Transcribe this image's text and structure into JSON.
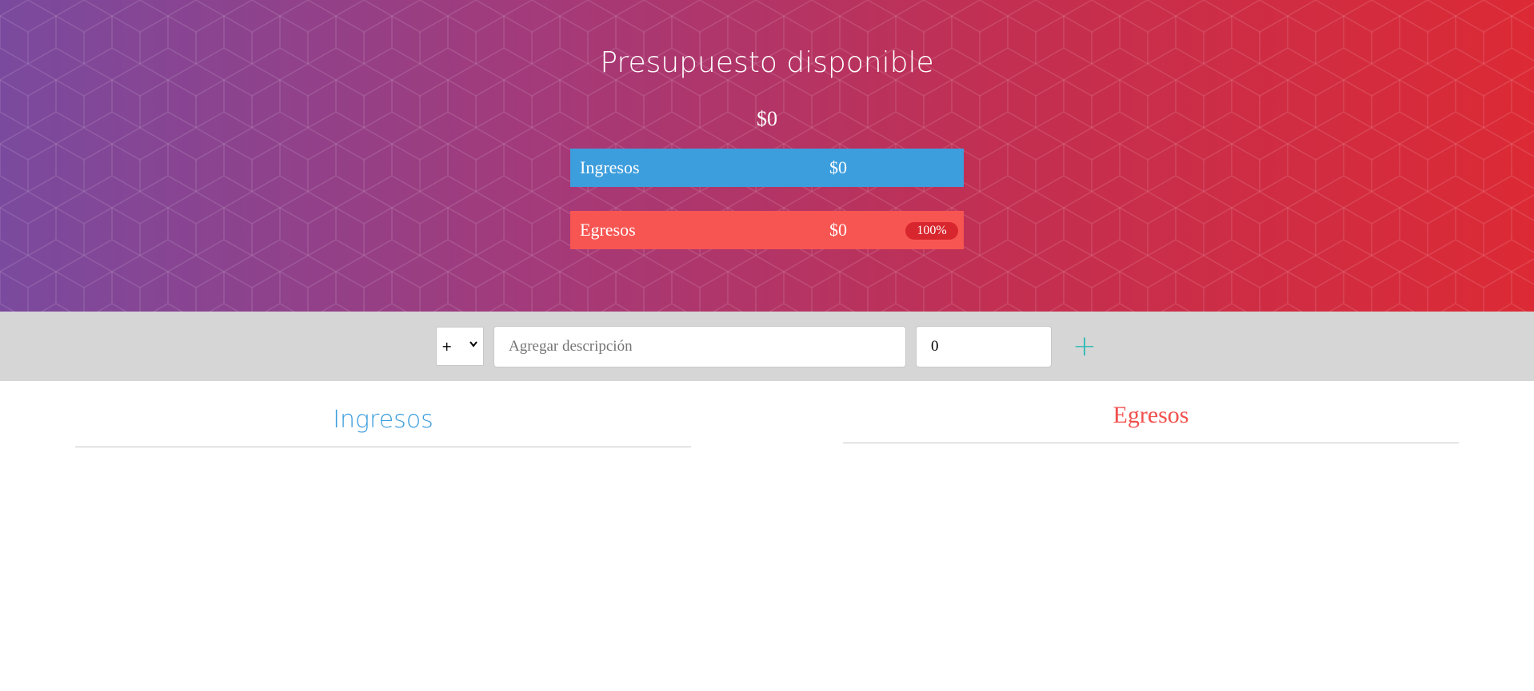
{
  "header": {
    "title": "Presupuesto disponible",
    "total": "$0",
    "ingresos": {
      "label": "Ingresos",
      "value": "$0"
    },
    "egresos": {
      "label": "Egresos",
      "value": "$0",
      "percentage": "100%"
    }
  },
  "add_bar": {
    "type_selected": "+",
    "type_options": [
      "+"
    ],
    "description_placeholder": "Agregar descripción",
    "value": "0",
    "add_icon": "plus-icon",
    "add_label": "+"
  },
  "lists": {
    "ingresos_title": "Ingresos",
    "egresos_title": "Egresos"
  },
  "colors": {
    "header_gradient_start": "#7a4a9e",
    "header_gradient_end": "#dc2a35",
    "ingresos": "#3d9edd",
    "egresos": "#f75552",
    "badge": "#d8262e",
    "add_button": "#28b9b5",
    "add_bar": "#d6d6d6"
  }
}
